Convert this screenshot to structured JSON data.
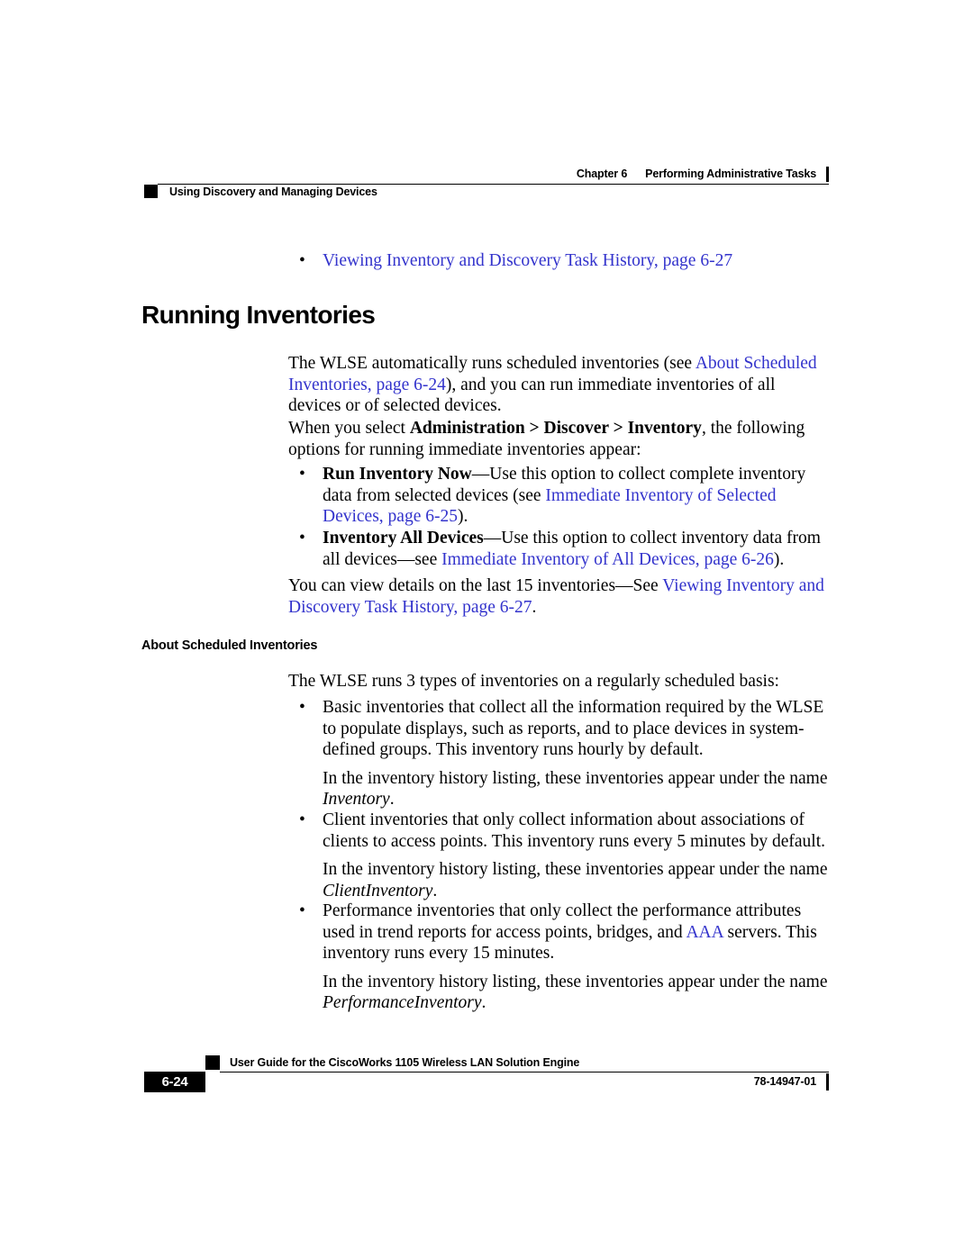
{
  "header": {
    "chapter_label": "Chapter 6",
    "chapter_title": "Performing Administrative Tasks",
    "left_title": "Using Discovery and Managing Devices"
  },
  "colors": {
    "link": "#3333CC",
    "text": "#000000",
    "page_background": "#FFFFFF"
  },
  "content": {
    "top_bullet": {
      "marker": "•",
      "link_text": "Viewing Inventory and Discovery Task History, page 6-27"
    },
    "section_title": "Running Inventories",
    "para_1": {
      "t1": "The WLSE automatically runs scheduled inventories (see ",
      "link1": "About Scheduled Inventories, page 6-24",
      "t2": "), and you can run immediate inventories of all devices or of selected devices."
    },
    "para_2": {
      "t1": "When you select ",
      "bold1": "Administration > Discover > Inventory",
      "t2": ", the following options for running immediate inventories appear:"
    },
    "option_bullets": [
      {
        "marker": "•",
        "bold": "Run Inventory Now",
        "t1": "—Use this option to collect complete inventory data from selected devices (see ",
        "link": "Immediate Inventory of Selected Devices, page 6-25",
        "t2": ")."
      },
      {
        "marker": "•",
        "bold": "Inventory All Devices",
        "t1": "—Use this option to collect inventory data from all devices—see ",
        "link": "Immediate Inventory of All Devices, page 6-26",
        "t2": ")."
      }
    ],
    "para_3": {
      "t1": "You can view details on the last 15 inventories—See ",
      "link": "Viewing Inventory and Discovery Task History, page 6-27",
      "t2": "."
    },
    "sub_title": "About Scheduled Inventories",
    "para_4": "The WLSE runs 3 types of inventories on a regularly scheduled basis:",
    "inventory_bullets": [
      {
        "marker": "•",
        "main": "Basic inventories that collect all the information required by the WLSE to populate displays, such as reports, and to place devices in system-defined groups. This inventory runs hourly by default.",
        "sub_prefix": "In the inventory history listing, these inventories appear under the name ",
        "sub_italic": "Inventory",
        "sub_suffix": "."
      },
      {
        "marker": "•",
        "main": "Client inventories that only collect information about associations of clients to access points. This inventory runs every 5 minutes by default.",
        "sub_prefix": "In the inventory history listing, these inventories appear under the name ",
        "sub_italic": "ClientInventory",
        "sub_suffix": "."
      },
      {
        "marker": "•",
        "main_t1": "Performance inventories that only collect the performance attributes used in trend reports for access points, bridges, and ",
        "main_link": "AAA",
        "main_t2": " servers. This inventory runs every 15 minutes.",
        "sub_prefix": "In the inventory history listing, these inventories appear under the name ",
        "sub_italic": "PerformanceInventory",
        "sub_suffix": "."
      }
    ]
  },
  "footer": {
    "guide_title": "User Guide for the CiscoWorks 1105 Wireless LAN Solution Engine",
    "page_number": "6-24",
    "doc_id": "78-14947-01"
  }
}
